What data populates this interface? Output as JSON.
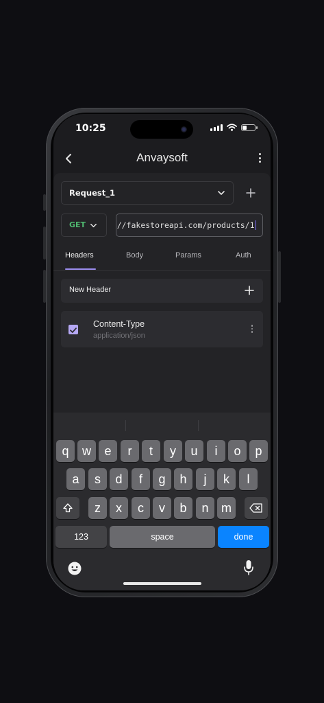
{
  "status": {
    "time": "10:25"
  },
  "nav": {
    "title": "Anvaysoft"
  },
  "request": {
    "name": "Request_1"
  },
  "method": {
    "label": "GET",
    "color": "#4fb870"
  },
  "url": {
    "value": "://fakestoreapi.com/products/1"
  },
  "tabs": [
    {
      "label": "Headers",
      "active": true
    },
    {
      "label": "Body"
    },
    {
      "label": "Params"
    },
    {
      "label": "Auth"
    }
  ],
  "new_header": {
    "label": "New Header"
  },
  "headers": [
    {
      "key": "Content-Type",
      "value": "application/json",
      "checked": true
    }
  ],
  "keyboard": {
    "row1": [
      "q",
      "w",
      "e",
      "r",
      "t",
      "y",
      "u",
      "i",
      "o",
      "p"
    ],
    "row2": [
      "a",
      "s",
      "d",
      "f",
      "g",
      "h",
      "j",
      "k",
      "l"
    ],
    "row3": [
      "z",
      "x",
      "c",
      "v",
      "b",
      "n",
      "m"
    ],
    "numbers_label": "123",
    "space_label": "space",
    "done_label": "done"
  },
  "colors": {
    "accent": "#9c8ef0",
    "checkbox": "#b5a8f4",
    "done": "#0a84ff"
  }
}
